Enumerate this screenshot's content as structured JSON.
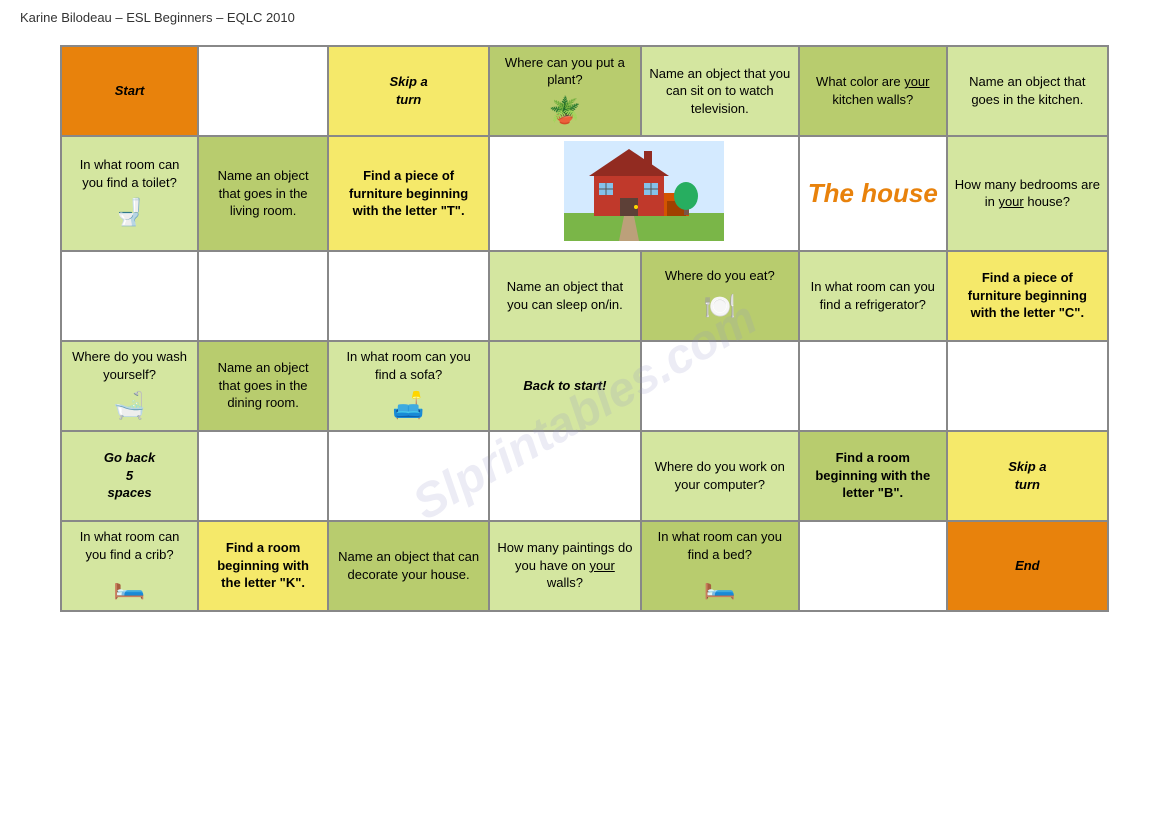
{
  "header": {
    "credit": "Karine Bilodeau – ESL Beginners – EQLC 2010"
  },
  "watermark": "Slprintables.com",
  "board": {
    "rows": [
      {
        "cells": [
          {
            "type": "start",
            "text": "Start",
            "style": "cell-title-start",
            "colspan": 1,
            "rowspan": 1
          },
          {
            "type": "empty",
            "text": "",
            "style": "cell-empty",
            "colspan": 1,
            "rowspan": 1
          },
          {
            "type": "skip",
            "text": "Skip a turn",
            "style": "cell-skip",
            "colspan": 1,
            "rowspan": 1
          },
          {
            "type": "green",
            "text": "Where can you put a plant?",
            "style": "cell-green",
            "icon": "🌱",
            "colspan": 1,
            "rowspan": 1
          },
          {
            "type": "lightgreen",
            "text": "Name an object that you can sit on to watch television.",
            "style": "cell-lightgreen",
            "colspan": 1,
            "rowspan": 1
          },
          {
            "type": "green",
            "text": "What color are your kitchen walls?",
            "style": "cell-green",
            "colspan": 1,
            "rowspan": 1
          },
          {
            "type": "lightgreen",
            "text": "Name an object that goes in the kitchen.",
            "style": "cell-lightgreen",
            "colspan": 1,
            "rowspan": 1
          }
        ]
      },
      {
        "cells": [
          {
            "type": "lightgreen",
            "text": "In what room can you find a toilet?",
            "style": "cell-lightgreen",
            "icon": "🚽",
            "colspan": 1,
            "rowspan": 1
          },
          {
            "type": "green",
            "text": "Name an object that goes in the living room.",
            "style": "cell-green",
            "colspan": 1,
            "rowspan": 1
          },
          {
            "type": "bold_green",
            "text": "Find a piece of furniture beginning with the letter \"T\".",
            "style": "cell-yellow",
            "bold": true,
            "colspan": 1,
            "rowspan": 1
          },
          {
            "type": "house_image",
            "text": "",
            "style": "cell-img-house",
            "colspan": 2,
            "rowspan": 1
          },
          {
            "type": "house_title",
            "text": "The house",
            "style": "cell-house-title",
            "colspan": 1,
            "rowspan": 1
          },
          {
            "type": "lightgreen",
            "text": "How many bedrooms are in your house?",
            "style": "cell-lightgreen",
            "colspan": 1,
            "rowspan": 1
          }
        ]
      },
      {
        "cells": [
          {
            "type": "empty2",
            "text": "",
            "style": "cell-empty",
            "colspan": 3,
            "rowspan": 1
          },
          {
            "type": "lightgreen",
            "text": "Name an object that you can sleep on/in.",
            "style": "cell-lightgreen",
            "colspan": 1,
            "rowspan": 1
          },
          {
            "type": "green",
            "text": "Where do you eat?",
            "style": "cell-green",
            "icon": "🍽️",
            "colspan": 1,
            "rowspan": 1
          },
          {
            "type": "lightgreen",
            "text": "In what room can you find a refrigerator?",
            "style": "cell-lightgreen",
            "colspan": 1,
            "rowspan": 1
          },
          {
            "type": "bold_yellow",
            "text": "Find a piece of furniture beginning with the letter \"C\".",
            "style": "cell-yellow",
            "bold": true,
            "colspan": 1,
            "rowspan": 1
          }
        ]
      },
      {
        "cells": [
          {
            "type": "lightgreen",
            "text": "Where do you wash yourself?",
            "style": "cell-lightgreen",
            "icon": "🛁",
            "colspan": 1,
            "rowspan": 1
          },
          {
            "type": "green",
            "text": "Name an object that goes in the dining room.",
            "style": "cell-green",
            "colspan": 1,
            "rowspan": 1
          },
          {
            "type": "lightgreen",
            "text": "In what room can you find a sofa?",
            "style": "cell-lightgreen",
            "icon": "🛋️",
            "colspan": 1,
            "rowspan": 1
          },
          {
            "type": "back",
            "text": "Back to start!",
            "style": "cell-back",
            "colspan": 1,
            "rowspan": 1
          },
          {
            "type": "empty",
            "text": "",
            "style": "cell-empty",
            "colspan": 3,
            "rowspan": 1
          }
        ]
      },
      {
        "cells": [
          {
            "type": "goback",
            "text": "Go back 5 spaces",
            "style": "cell-gobback",
            "colspan": 1,
            "rowspan": 1
          },
          {
            "type": "empty",
            "text": "",
            "style": "cell-empty",
            "colspan": 2,
            "rowspan": 1
          },
          {
            "type": "empty",
            "text": "",
            "style": "cell-empty",
            "colspan": 1,
            "rowspan": 1
          },
          {
            "type": "lightgreen",
            "text": "Where do you work on your computer?",
            "style": "cell-lightgreen",
            "colspan": 1,
            "rowspan": 1
          },
          {
            "type": "bold_green2",
            "text": "Find a room beginning with the letter \"B\".",
            "style": "cell-green",
            "bold": true,
            "colspan": 1,
            "rowspan": 1
          },
          {
            "type": "skip2",
            "text": "Skip a turn",
            "style": "cell-skip",
            "colspan": 1,
            "rowspan": 1
          }
        ]
      },
      {
        "cells": [
          {
            "type": "lightgreen",
            "text": "In what room can you find a crib?",
            "style": "cell-lightgreen",
            "icon": "🛏️",
            "colspan": 1,
            "rowspan": 1
          },
          {
            "type": "bold_yellow2",
            "text": "Find a room beginning with the letter \"K\".",
            "style": "cell-yellow",
            "bold": true,
            "colspan": 1,
            "rowspan": 1
          },
          {
            "type": "green",
            "text": "Name an object that can decorate your house.",
            "style": "cell-green",
            "colspan": 1,
            "rowspan": 1
          },
          {
            "type": "lightgreen",
            "text": "How many paintings do you have on your walls?",
            "style": "cell-lightgreen",
            "underline": "your",
            "colspan": 1,
            "rowspan": 1
          },
          {
            "type": "green",
            "text": "In what room can you find a bed?",
            "style": "cell-green",
            "icon": "🛏️",
            "colspan": 1,
            "rowspan": 1
          },
          {
            "type": "empty",
            "text": "",
            "style": "cell-empty",
            "colspan": 1,
            "rowspan": 1
          },
          {
            "type": "end",
            "text": "End",
            "style": "cell-title-end",
            "colspan": 1,
            "rowspan": 1
          }
        ]
      }
    ]
  }
}
